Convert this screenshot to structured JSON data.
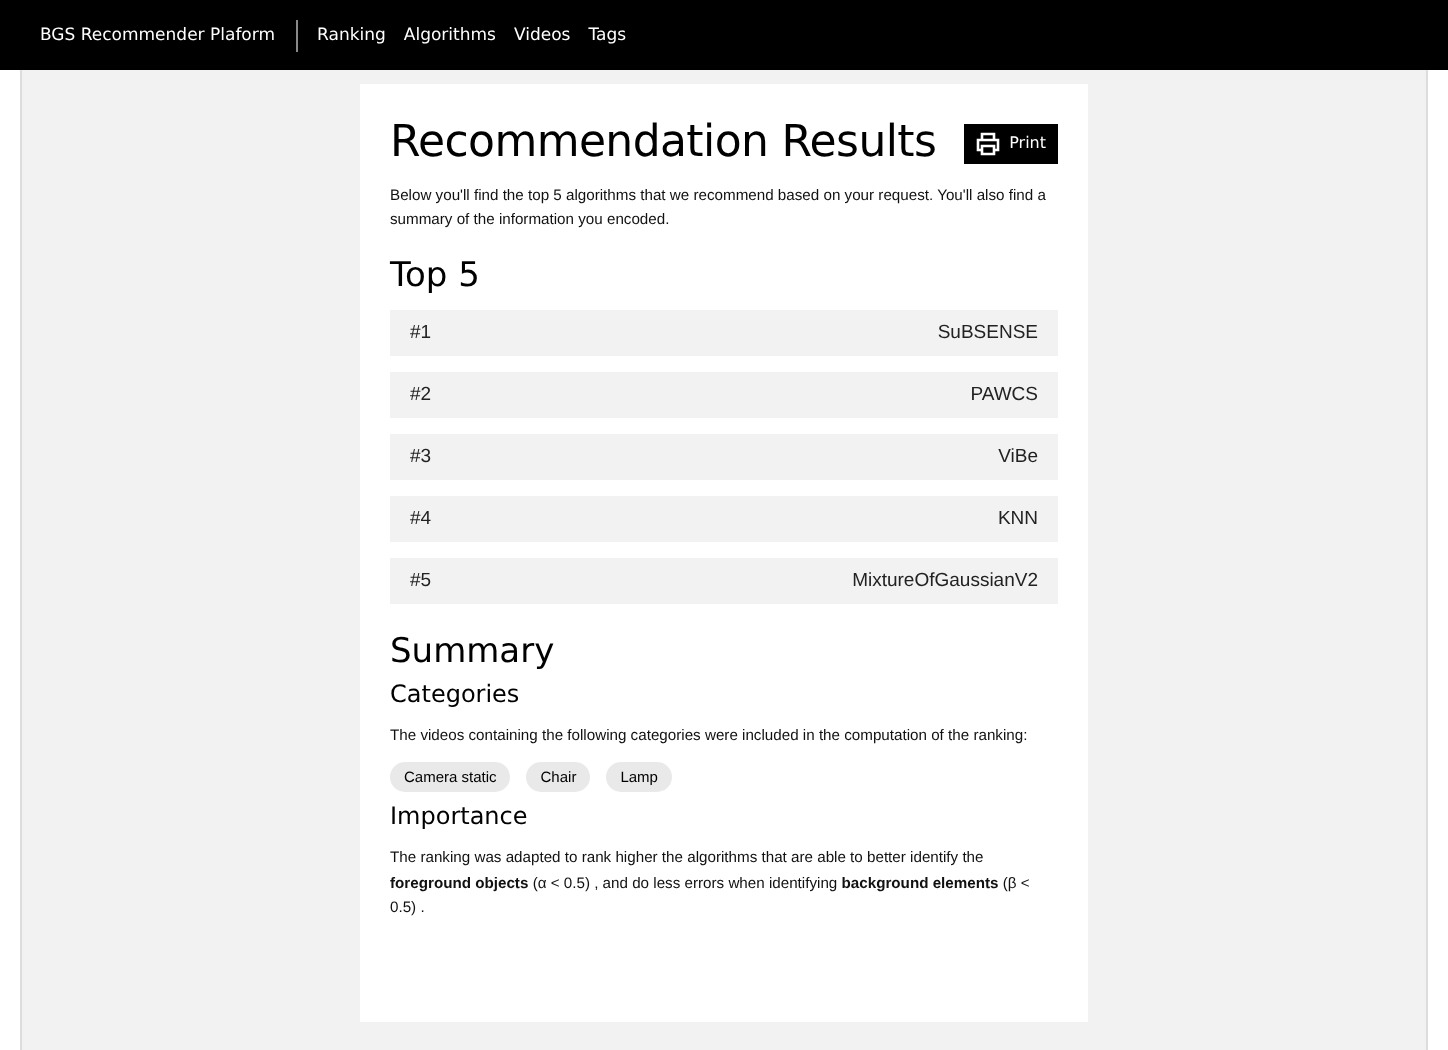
{
  "navbar": {
    "brand": "BGS Recommender Plaform",
    "links": [
      "Ranking",
      "Algorithms",
      "Videos",
      "Tags"
    ]
  },
  "page": {
    "title": "Recommendation Results",
    "print_button": "Print",
    "intro": "Below you'll find the top 5 algorithms that we recommend based on your request. You'll also find a summary of the information you encoded."
  },
  "top": {
    "heading": "Top 5",
    "rows": [
      {
        "rank": "#1",
        "name": "SuBSENSE"
      },
      {
        "rank": "#2",
        "name": "PAWCS"
      },
      {
        "rank": "#3",
        "name": "ViBe"
      },
      {
        "rank": "#4",
        "name": "KNN"
      },
      {
        "rank": "#5",
        "name": "MixtureOfGaussianV2"
      }
    ]
  },
  "summary": {
    "heading": "Summary",
    "categories_heading": "Categories",
    "categories_text": "The videos containing the following categories were included in the computation of the ranking:",
    "tags": [
      "Camera static",
      "Chair",
      "Lamp"
    ],
    "importance_heading": "Importance",
    "importance_text": "The ranking was adapted to rank higher the algorithms that are able to better identify the **foreground objects** (α < 0.5) , and do less errors when identifying **background elements** (β < 0.5) ."
  }
}
